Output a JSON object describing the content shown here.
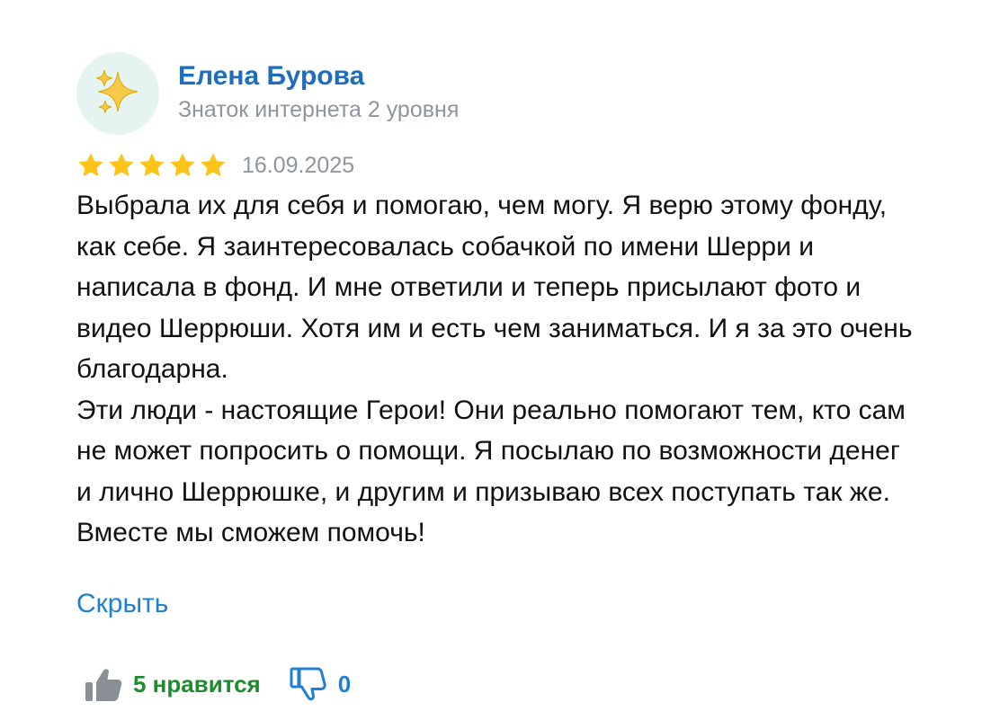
{
  "review": {
    "author": {
      "name": "Елена Бурова",
      "level": "Знаток интернета 2 уровня",
      "avatar_icon": "sparkles-icon",
      "avatar_background": "#e6f4f1"
    },
    "rating": {
      "value": 5,
      "max": 5,
      "star_color": "#fcc419"
    },
    "date": "16.09.2025",
    "text": {
      "paragraph_1": "Выбрала их для себя и помогаю, чем могу. Я верю этому фонду, как себе. Я заинтересовалась собачкой по имени Шерри и написала в фонд. И мне ответили и теперь присылают фото и видео Шеррюши. Хотя им и есть чем заниматься. И я за это очень благодарна.",
      "paragraph_2": "Эти люди - настоящие Герои! Они реально помогают тем, кто сам не может попросить о помощи. Я посылаю по возможности денег и лично Шеррюшке, и другим и призываю всех поступать так же. Вместе мы сможем помочь!"
    },
    "collapse_label": "Скрыть",
    "reactions": {
      "like_label": "5 нравится",
      "like_icon": "thumbs-up-icon",
      "like_color": "#1f8a2e",
      "dislike_count": "0",
      "dislike_icon": "thumbs-down-icon",
      "dislike_color": "#1f7fd1"
    },
    "colors": {
      "author_name": "#1f6ebd",
      "meta_text": "#8f959d",
      "link": "#1f7fd1"
    }
  }
}
